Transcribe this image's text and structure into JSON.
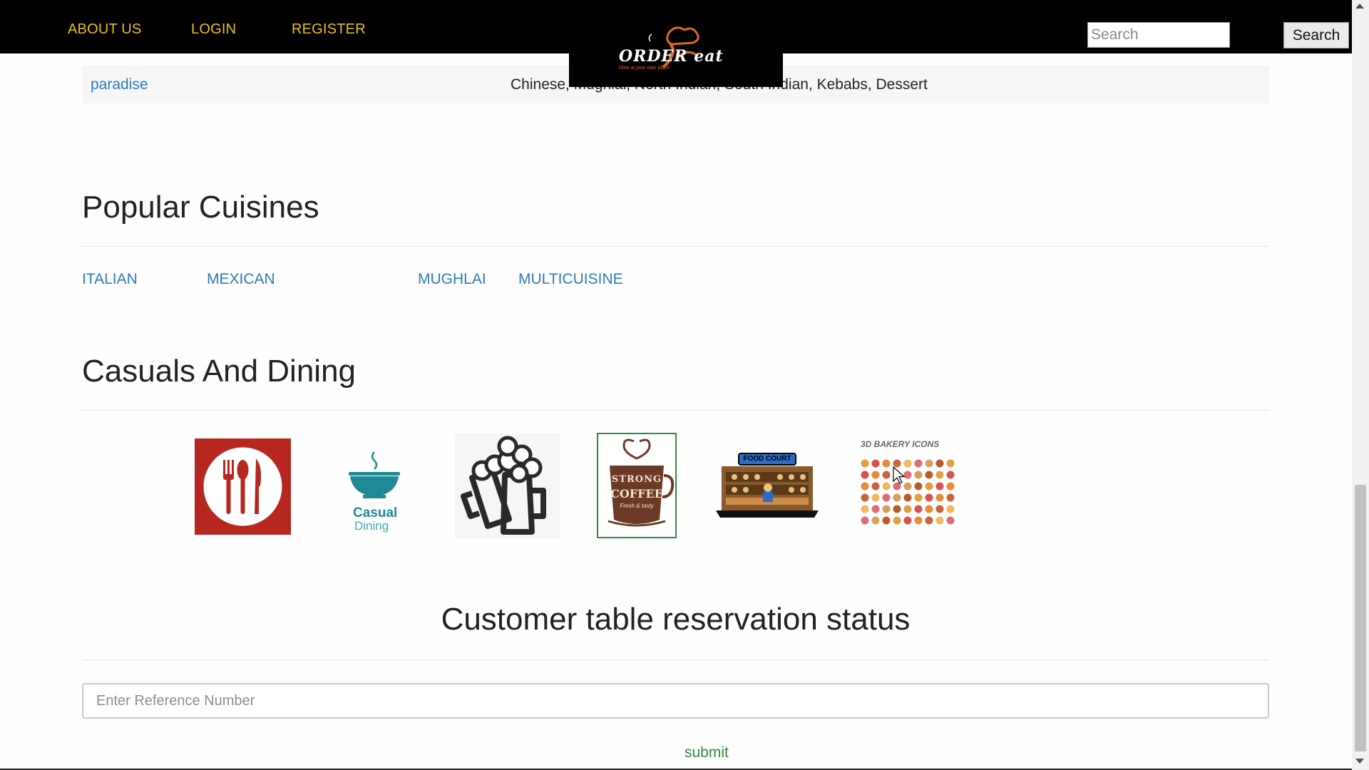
{
  "nav": {
    "links": [
      "ABOUT US",
      "LOGIN",
      "REGISTER"
    ],
    "logo_text": "ORDER eat",
    "logo_tagline": "Dine at your own place",
    "search_placeholder": "Search",
    "search_button": "Search"
  },
  "restaurant_row": {
    "name": "paradise",
    "cuisines": "Chinese, Mughlai, North Indian, South Indian, Kebabs, Dessert"
  },
  "popular_cuisines": {
    "title": "Popular Cuisines",
    "items": [
      "ITALIAN",
      "MEXICAN",
      "MUGHLAI",
      "MULTICUISINE"
    ]
  },
  "casuals": {
    "title": "Casuals And Dining",
    "tiles": [
      {
        "icon": "fork-spoon-knife-icon",
        "color": "#b6281f"
      },
      {
        "icon": "casual-dining-bowl-icon",
        "label_line1": "Casual",
        "label_line2": "Dining",
        "color": "#1e8a96"
      },
      {
        "icon": "beer-mugs-icon"
      },
      {
        "icon": "strong-coffee-icon",
        "label_line1": "STRONG",
        "label_line2": "COFFEE",
        "label_line3": "Fresh & tasty",
        "color": "#6b3a26"
      },
      {
        "icon": "food-court-icon",
        "label": "FOOD COURT"
      },
      {
        "icon": "bakery-icons-grid-icon",
        "label": "3D BAKERY ICONS"
      }
    ]
  },
  "reservation": {
    "title": "Customer table reservation status",
    "input_placeholder": "Enter Reference Number",
    "submit_label": "submit"
  }
}
